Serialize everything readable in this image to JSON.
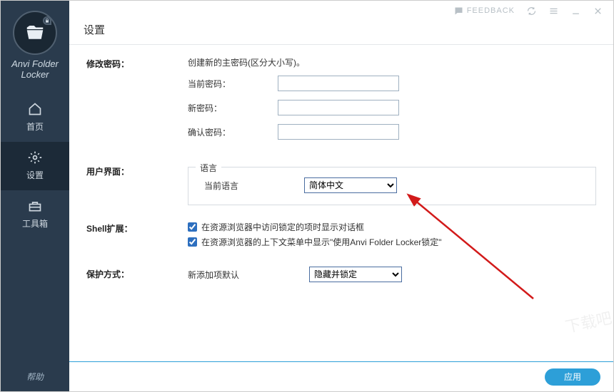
{
  "app": {
    "name_line1": "Anvi Folder",
    "name_line2": "Locker"
  },
  "topbar": {
    "feedback": "FEEDBACK"
  },
  "nav": {
    "home": "首页",
    "settings": "设置",
    "toolbox": "工具箱",
    "help": "帮助"
  },
  "page": {
    "title": "设置"
  },
  "sections": {
    "password": {
      "label": "修改密码：",
      "hint": "创建新的主密码(区分大小写)。",
      "current": "当前密码：",
      "new": "新密码：",
      "confirm": "确认密码："
    },
    "ui": {
      "label": "用户界面：",
      "legend": "语言",
      "current_lang_label": "当前语言",
      "lang_value": "简体中文"
    },
    "shell": {
      "label": "Shell扩展：",
      "opt1": "在资源浏览器中访问锁定的项时显示对话框",
      "opt2": "在资源浏览器的上下文菜单中显示\"使用Anvi Folder Locker锁定\""
    },
    "protect": {
      "label": "保护方式：",
      "default_label": "新添加项默认",
      "default_value": "隐藏并锁定"
    }
  },
  "footer": {
    "apply": "应用"
  }
}
